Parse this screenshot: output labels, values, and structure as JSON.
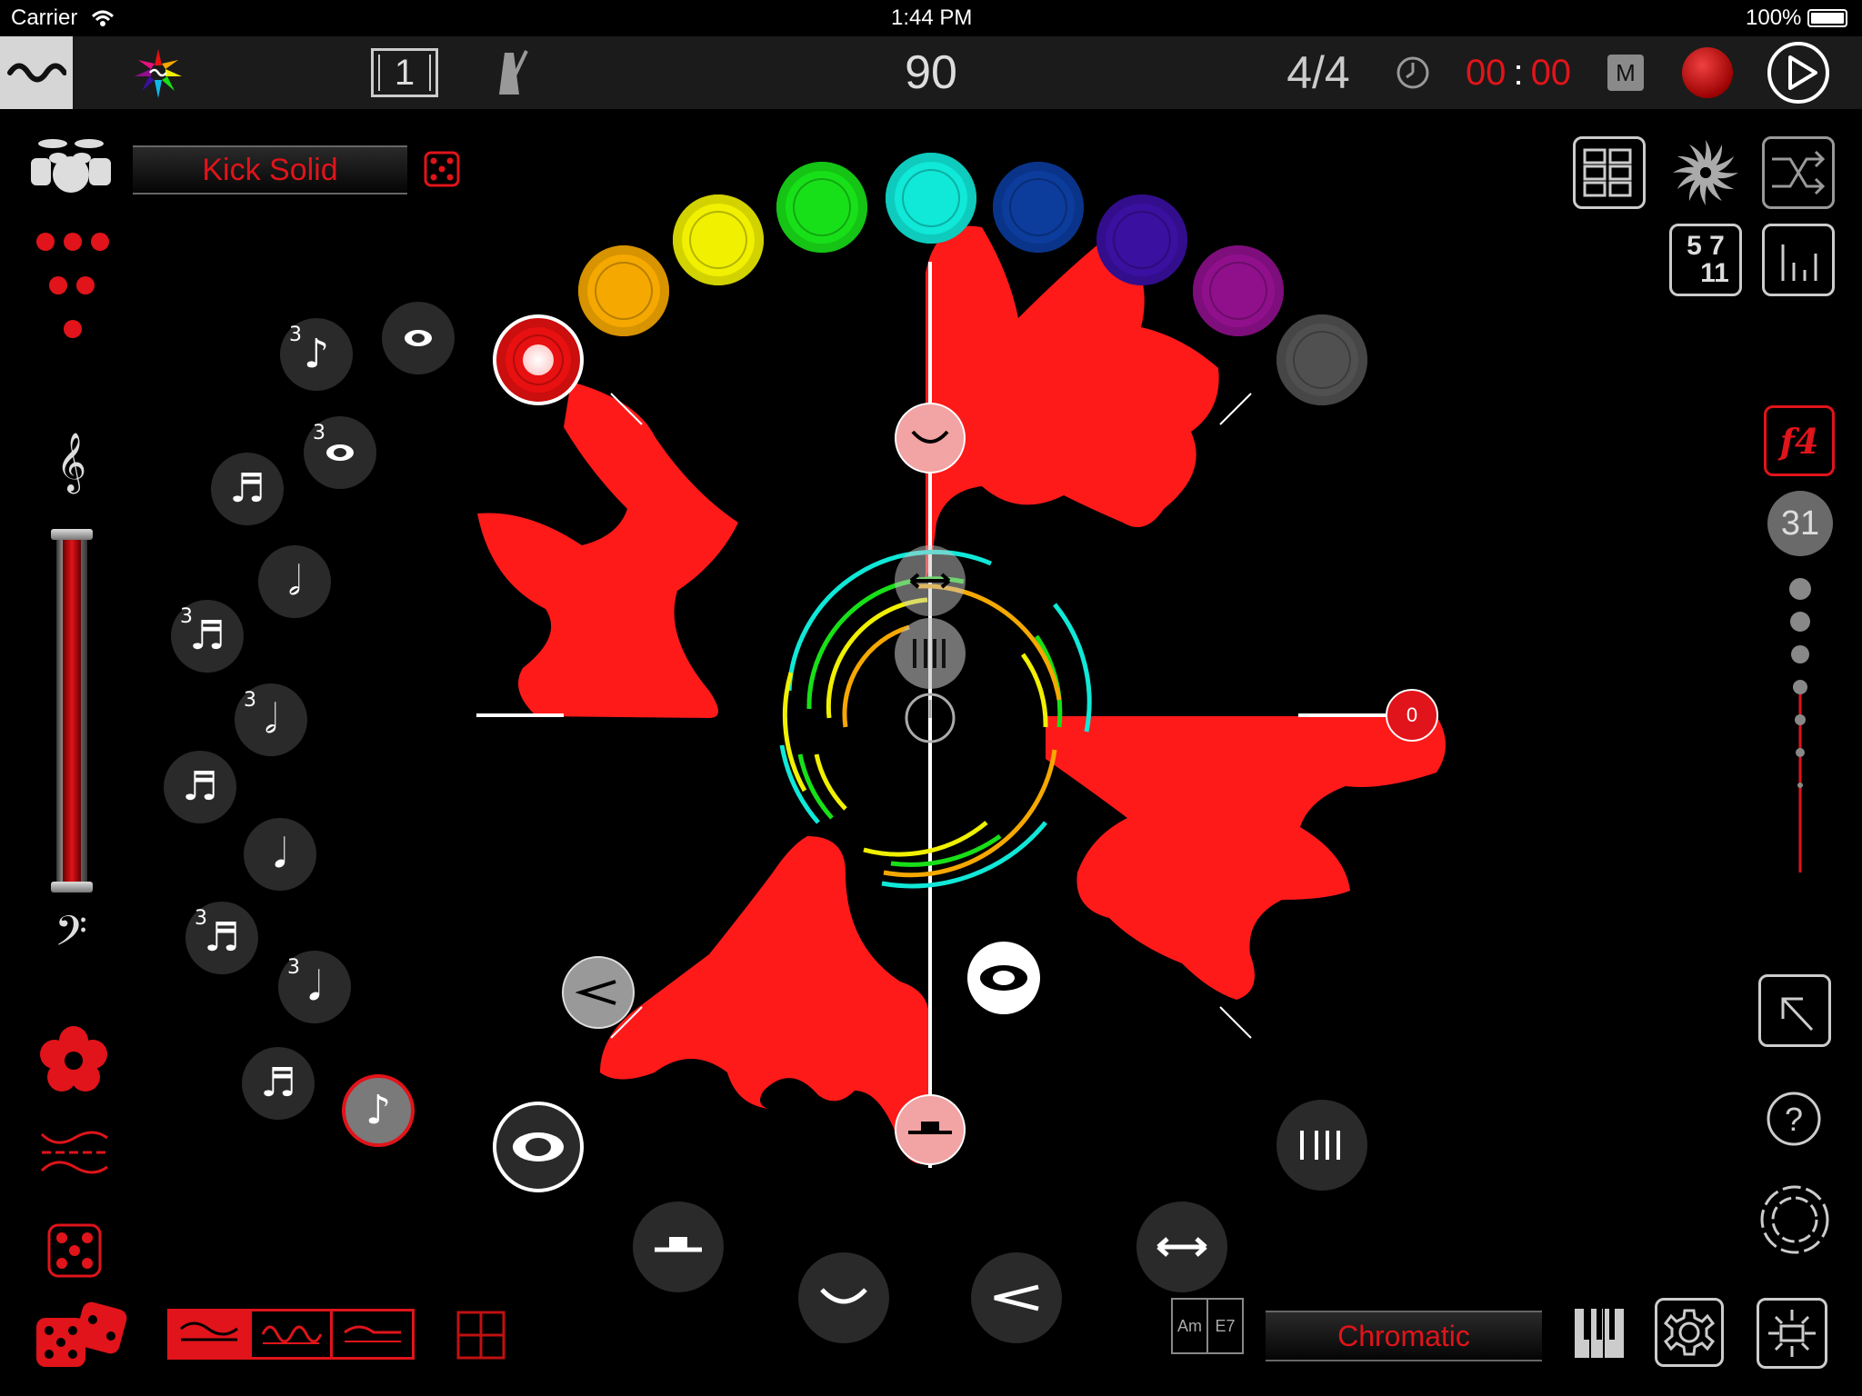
{
  "status_bar": {
    "carrier": "Carrier",
    "time": "1:44 PM",
    "battery": "100%"
  },
  "toolbar": {
    "bar_count": "1",
    "tempo": "90",
    "time_signature": "4/4",
    "timer_minutes": "00",
    "timer_separator": ":",
    "timer_seconds": "00",
    "mute_label": "M"
  },
  "left_panel": {
    "instrument_name": "Kick Solid"
  },
  "note_values": {
    "triplet_marker": "3"
  },
  "right_panel": {
    "tuplet_top": "5 7",
    "tuplet_bottom": "11",
    "dynamic_label": "f4",
    "count": "31"
  },
  "center": {
    "beat_marker_value": "0"
  },
  "bottom_bar": {
    "chord_left": "Am",
    "chord_right": "E7",
    "scale_name": "Chromatic"
  },
  "colors": {
    "accent_red": "#e0141a",
    "toolbar_bg": "#1b1b1b",
    "wave_fill": "#ff1a1a",
    "palette": [
      "#e81010",
      "#f5a800",
      "#f0f000",
      "#18e018",
      "#10e8d8",
      "#0c3c9c",
      "#3a10a0",
      "#90108c",
      "#505050"
    ]
  },
  "icons": {
    "app_logo": "wave-icon",
    "color_wheel": "color-burst-icon",
    "metronome": "metronome-icon",
    "clock": "clock-icon",
    "record": "record-icon",
    "play": "play-icon",
    "drums": "drum-kit-icon",
    "dice": "dice-icon",
    "grid": "grid-icon",
    "spiral": "spiral-icon",
    "shuffle": "shuffle-icon",
    "bars": "bar-chart-icon",
    "undo": "undo-icon",
    "help": "help-icon",
    "settings": "gear-icon",
    "piano": "piano-icon"
  }
}
